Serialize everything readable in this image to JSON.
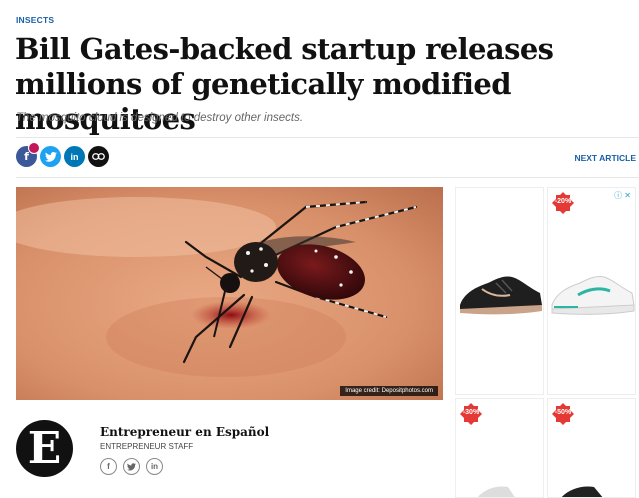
{
  "article": {
    "category": "INSECTS",
    "title": "Bill Gates-backed startup releases millions of genetically modified mosquitoes",
    "subtitle": "The mosquito cloud is designed to destroy other insects.",
    "next_article": "NEXT ARTICLE",
    "image_credit": "Image credit: Depositphotos.com"
  },
  "share": {
    "facebook": "f",
    "linkedin": "in"
  },
  "author": {
    "logo_letter": "E",
    "name": "Entrepreneur en Español",
    "role": "ENTREPRENEUR STAFF",
    "linkedin": "in"
  },
  "ad": {
    "adchoice": "ⓘ ✕",
    "badges": [
      "-20%",
      "-30%",
      "-50%"
    ]
  },
  "colors": {
    "accent": "#1a5fa8",
    "facebook": "#3b5998",
    "twitter": "#1da1f2",
    "linkedin": "#0077b5",
    "sale": "#e53935"
  }
}
